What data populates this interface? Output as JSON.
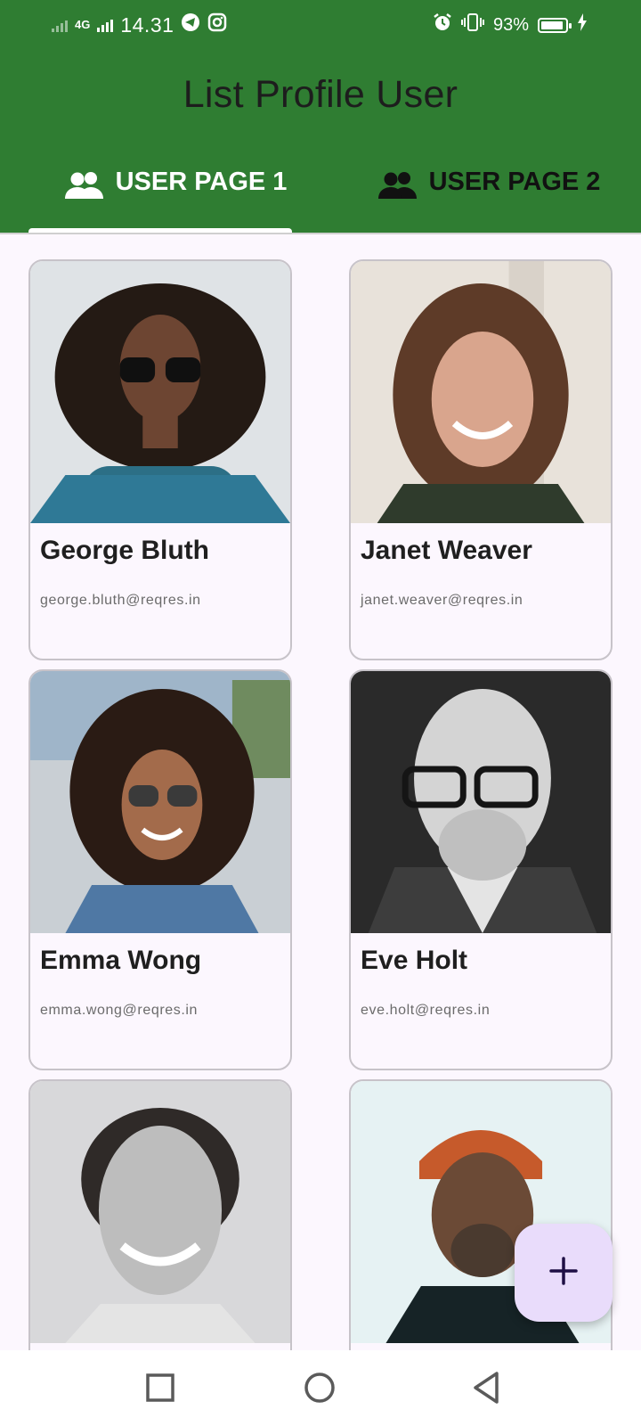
{
  "status_bar": {
    "network": "4G",
    "time": "14.31",
    "battery_percent": "93%",
    "battery_level": 0.93,
    "icons": [
      "signal-icon",
      "telegram-icon",
      "instagram-icon",
      "alarm-icon",
      "vibrate-icon",
      "battery-icon",
      "charging-icon"
    ]
  },
  "app_bar": {
    "title": "List Profile User",
    "color": "#2f7d32"
  },
  "tabs": [
    {
      "label": "USER PAGE 1",
      "icon": "people-icon",
      "selected": true
    },
    {
      "label": "USER PAGE 2",
      "icon": "people-icon",
      "selected": false
    }
  ],
  "users": [
    {
      "name": "George Bluth",
      "email": "george.bluth@reqres.in"
    },
    {
      "name": "Janet Weaver",
      "email": "janet.weaver@reqres.in"
    },
    {
      "name": "Emma Wong",
      "email": "emma.wong@reqres.in"
    },
    {
      "name": "Eve Holt",
      "email": "eve.holt@reqres.in"
    },
    {
      "name": "",
      "email": ""
    },
    {
      "name": "",
      "email": ""
    }
  ],
  "fab": {
    "icon": "plus-icon",
    "color": "#e9dcfb"
  },
  "nav_bar": {
    "icons": [
      "recent-apps-icon",
      "home-icon",
      "back-icon"
    ]
  }
}
